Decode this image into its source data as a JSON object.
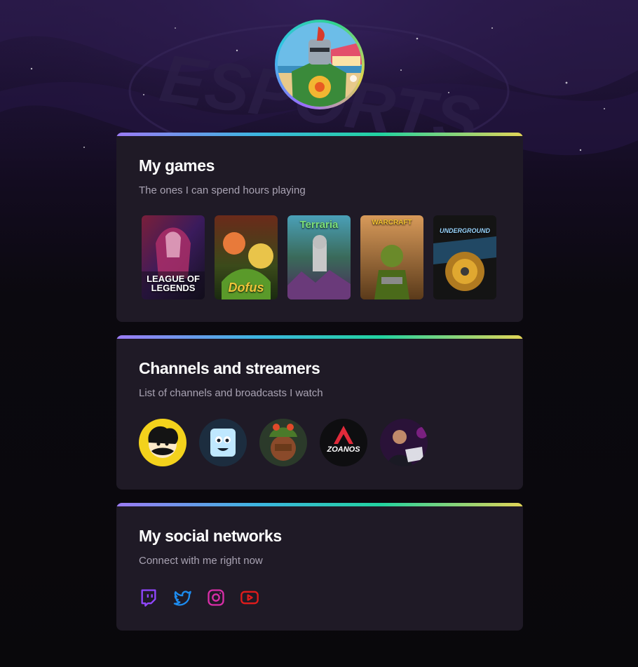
{
  "profile": {
    "avatar_icon": "knight-avatar-icon"
  },
  "background": {
    "watermark": "ESPORTS"
  },
  "games_card": {
    "title": "My games",
    "subtitle": "The ones I can spend hours playing",
    "games": [
      {
        "name": "League of Legends",
        "caption_line1": "LEAGUE OF",
        "caption_line2": "LEGENDS",
        "accent": "#c0357a"
      },
      {
        "name": "Dofus",
        "caption_line1": "",
        "caption_line2": "Dofus",
        "accent": "#e88c2a"
      },
      {
        "name": "Terraria",
        "caption_line1": "Terraria",
        "caption_line2": "",
        "accent": "#5fa86b"
      },
      {
        "name": "Warcraft III",
        "caption_line1": "WARCRAFT",
        "caption_line2": "",
        "accent": "#b05a2a"
      },
      {
        "name": "Need for Speed Underground 2",
        "caption_line1": "UNDERGROUND",
        "caption_line2": "",
        "accent": "#2a7fb0"
      }
    ]
  },
  "channels_card": {
    "title": "Channels and streamers",
    "subtitle": "List of channels and broadcasts I watch",
    "channels": [
      {
        "icon": "mustache-character-avatar-icon",
        "bg": "#f3d21c"
      },
      {
        "icon": "ice-cube-character-avatar-icon",
        "bg": "#1c2d3f"
      },
      {
        "icon": "frog-hat-streamer-avatar-icon",
        "bg": "#2b3a2a"
      },
      {
        "icon": "zoanos-logo-avatar-icon",
        "label": "ZOANOS",
        "bg": "#0e0e10"
      },
      {
        "icon": "streamer-at-laptop-avatar-icon",
        "bg": "#2a1238"
      }
    ]
  },
  "social_card": {
    "title": "My social networks",
    "subtitle": "Connect with me right now",
    "networks": [
      {
        "name": "Twitch",
        "icon": "twitch-icon",
        "color": "#9146ff"
      },
      {
        "name": "Twitter",
        "icon": "twitter-icon",
        "color": "#1d8cf0"
      },
      {
        "name": "Instagram",
        "icon": "instagram-icon",
        "color": "#d92ea8"
      },
      {
        "name": "YouTube",
        "icon": "youtube-icon",
        "color": "#e01b1b"
      }
    ]
  }
}
